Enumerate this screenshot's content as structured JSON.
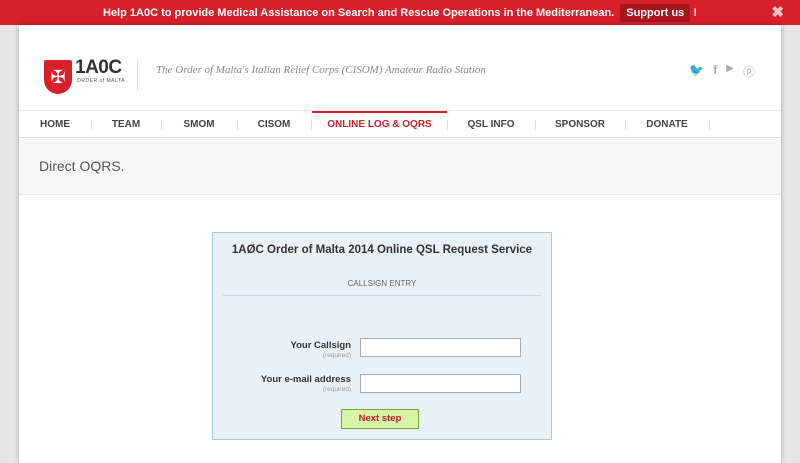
{
  "topbar": {
    "message": "Help 1A0C to provide Medical Assistance on Search and Rescue Operations in the Mediterranean.",
    "support_label": "Support us",
    "exclamation": "!",
    "close_glyph": "✖"
  },
  "header": {
    "logo_text": "1A0C",
    "logo_subtext": "ORDER of MALTA",
    "tagline": "The Order of Malta's Italian Relief Corps (CISOM) Amateur Radio Station",
    "social_icons": [
      "twitter-icon",
      "facebook-icon",
      "youtube-icon",
      "pinterest-icon"
    ],
    "social_glyphs": {
      "twitter": "🐦",
      "facebook": "f",
      "youtube": "▶",
      "pinterest": "ⓟ"
    }
  },
  "nav": {
    "items": [
      {
        "label": "HOME"
      },
      {
        "label": "TEAM"
      },
      {
        "label": "SMOM"
      },
      {
        "label": "CISOM"
      },
      {
        "label": "ONLINE LOG & OQRS",
        "active": true
      },
      {
        "label": "QSL INFO"
      },
      {
        "label": "SPONSOR"
      },
      {
        "label": "DONATE"
      }
    ]
  },
  "page": {
    "title": "Direct OQRS."
  },
  "qsl_form": {
    "title": "1AØC Order of Malta 2014 Online QSL Request Service",
    "subtitle": "CALLSIGN ENTRY",
    "callsign_label": "Your Callsign",
    "callsign_required": "(required)",
    "callsign_value": "",
    "email_label": "Your e-mail address",
    "email_required": "(required)",
    "email_value": "",
    "next_label": "Next step"
  },
  "colors": {
    "brand_red": "#d8202a",
    "form_bg": "#e9f1f8",
    "button_bg": "#d7f3a6"
  }
}
